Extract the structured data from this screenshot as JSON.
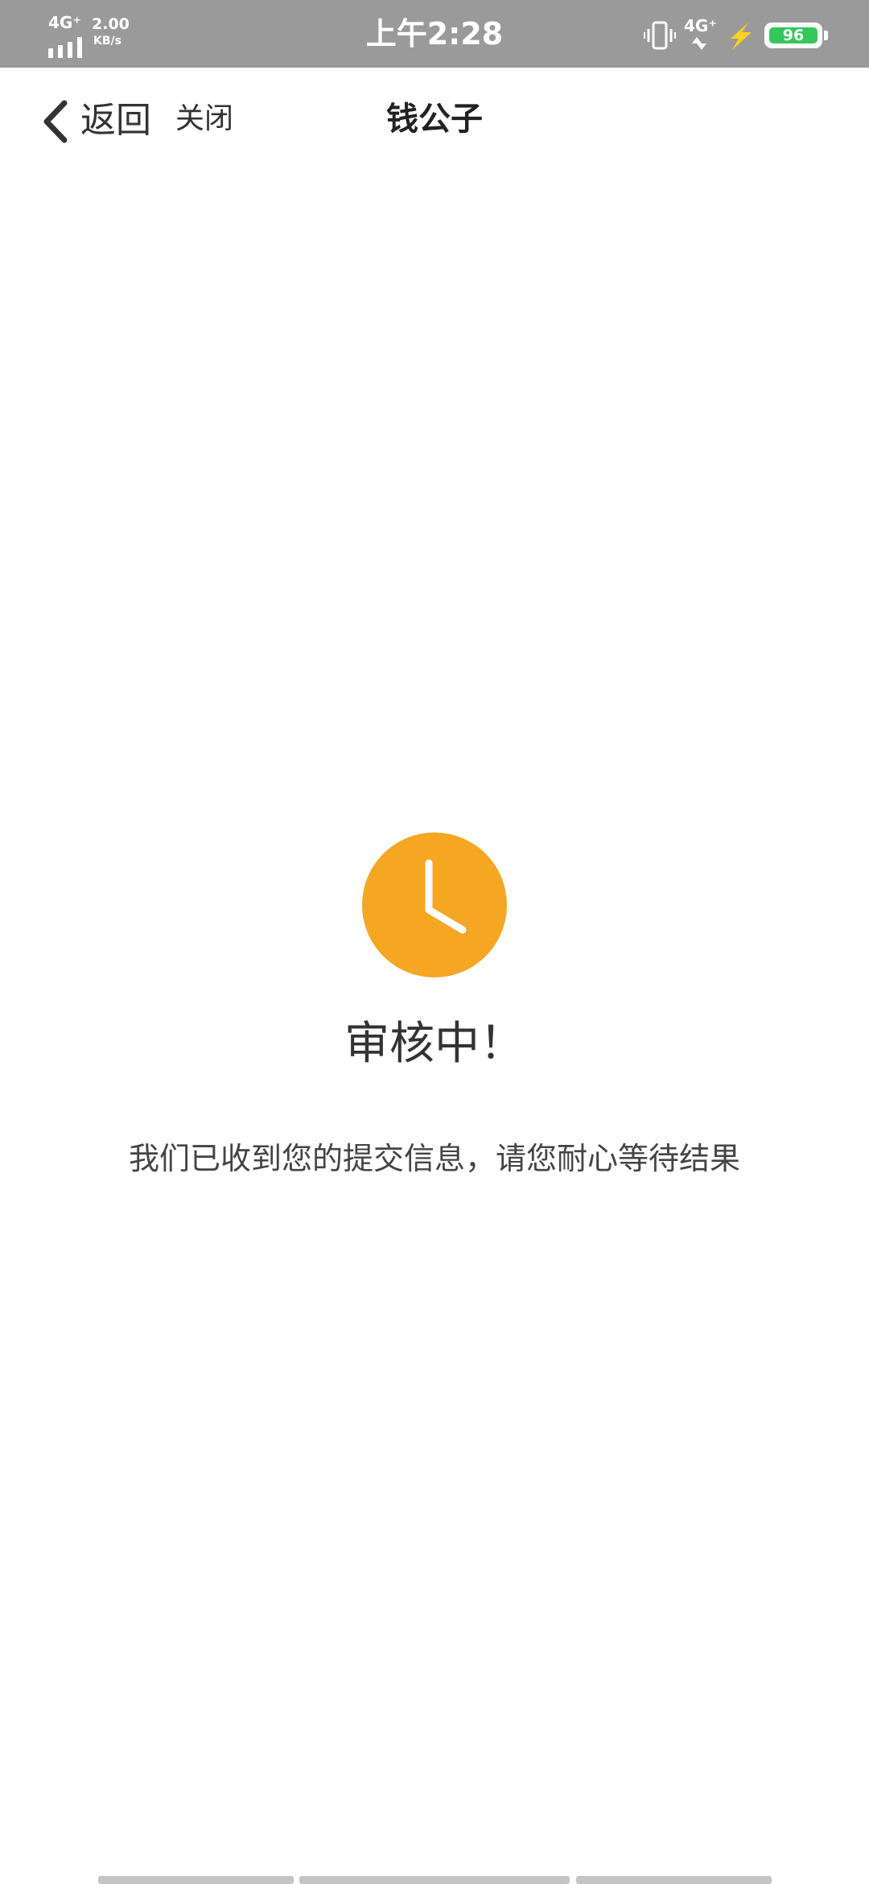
{
  "status_bar": {
    "network_left": "4G⁺",
    "speed": "2.00",
    "speed_unit": "KB/s",
    "time": "上午2:28",
    "network_right": "4G⁺",
    "battery_level": "96"
  },
  "nav": {
    "back_label": "返回",
    "close_label": "关闭",
    "title": "钱公子"
  },
  "content": {
    "status_title": "审核中！",
    "status_message": "我们已收到您的提交信息，请您耐心等待结果"
  },
  "colors": {
    "status_bar_bg": "#9a9a9a",
    "accent_orange": "#f5a623",
    "battery_green": "#35c759",
    "charge_yellow": "#f7d21e"
  },
  "icons": {
    "back": "chevron-left-icon",
    "status": "clock-icon",
    "vibrate": "vibrate-icon",
    "charging": "lightning-icon",
    "battery": "battery-icon",
    "signal": "signal-bars-icon"
  }
}
